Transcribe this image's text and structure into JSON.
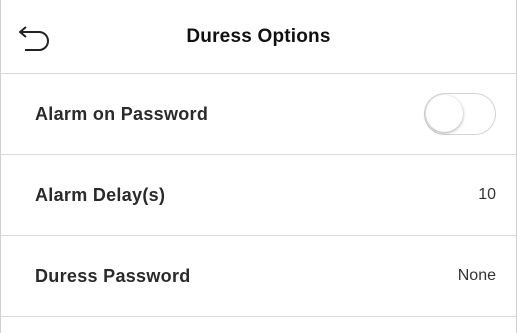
{
  "header": {
    "title": "Duress Options",
    "back_icon": "back-arrow-icon"
  },
  "rows": [
    {
      "label": "Alarm on Password",
      "type": "toggle",
      "enabled": false
    },
    {
      "label": "Alarm Delay(s)",
      "type": "value",
      "value": "10"
    },
    {
      "label": "Duress Password",
      "type": "value",
      "value": "None"
    }
  ],
  "colors": {
    "divider": "#d9d9d9",
    "text": "#2a2a2a",
    "background": "#ffffff"
  }
}
